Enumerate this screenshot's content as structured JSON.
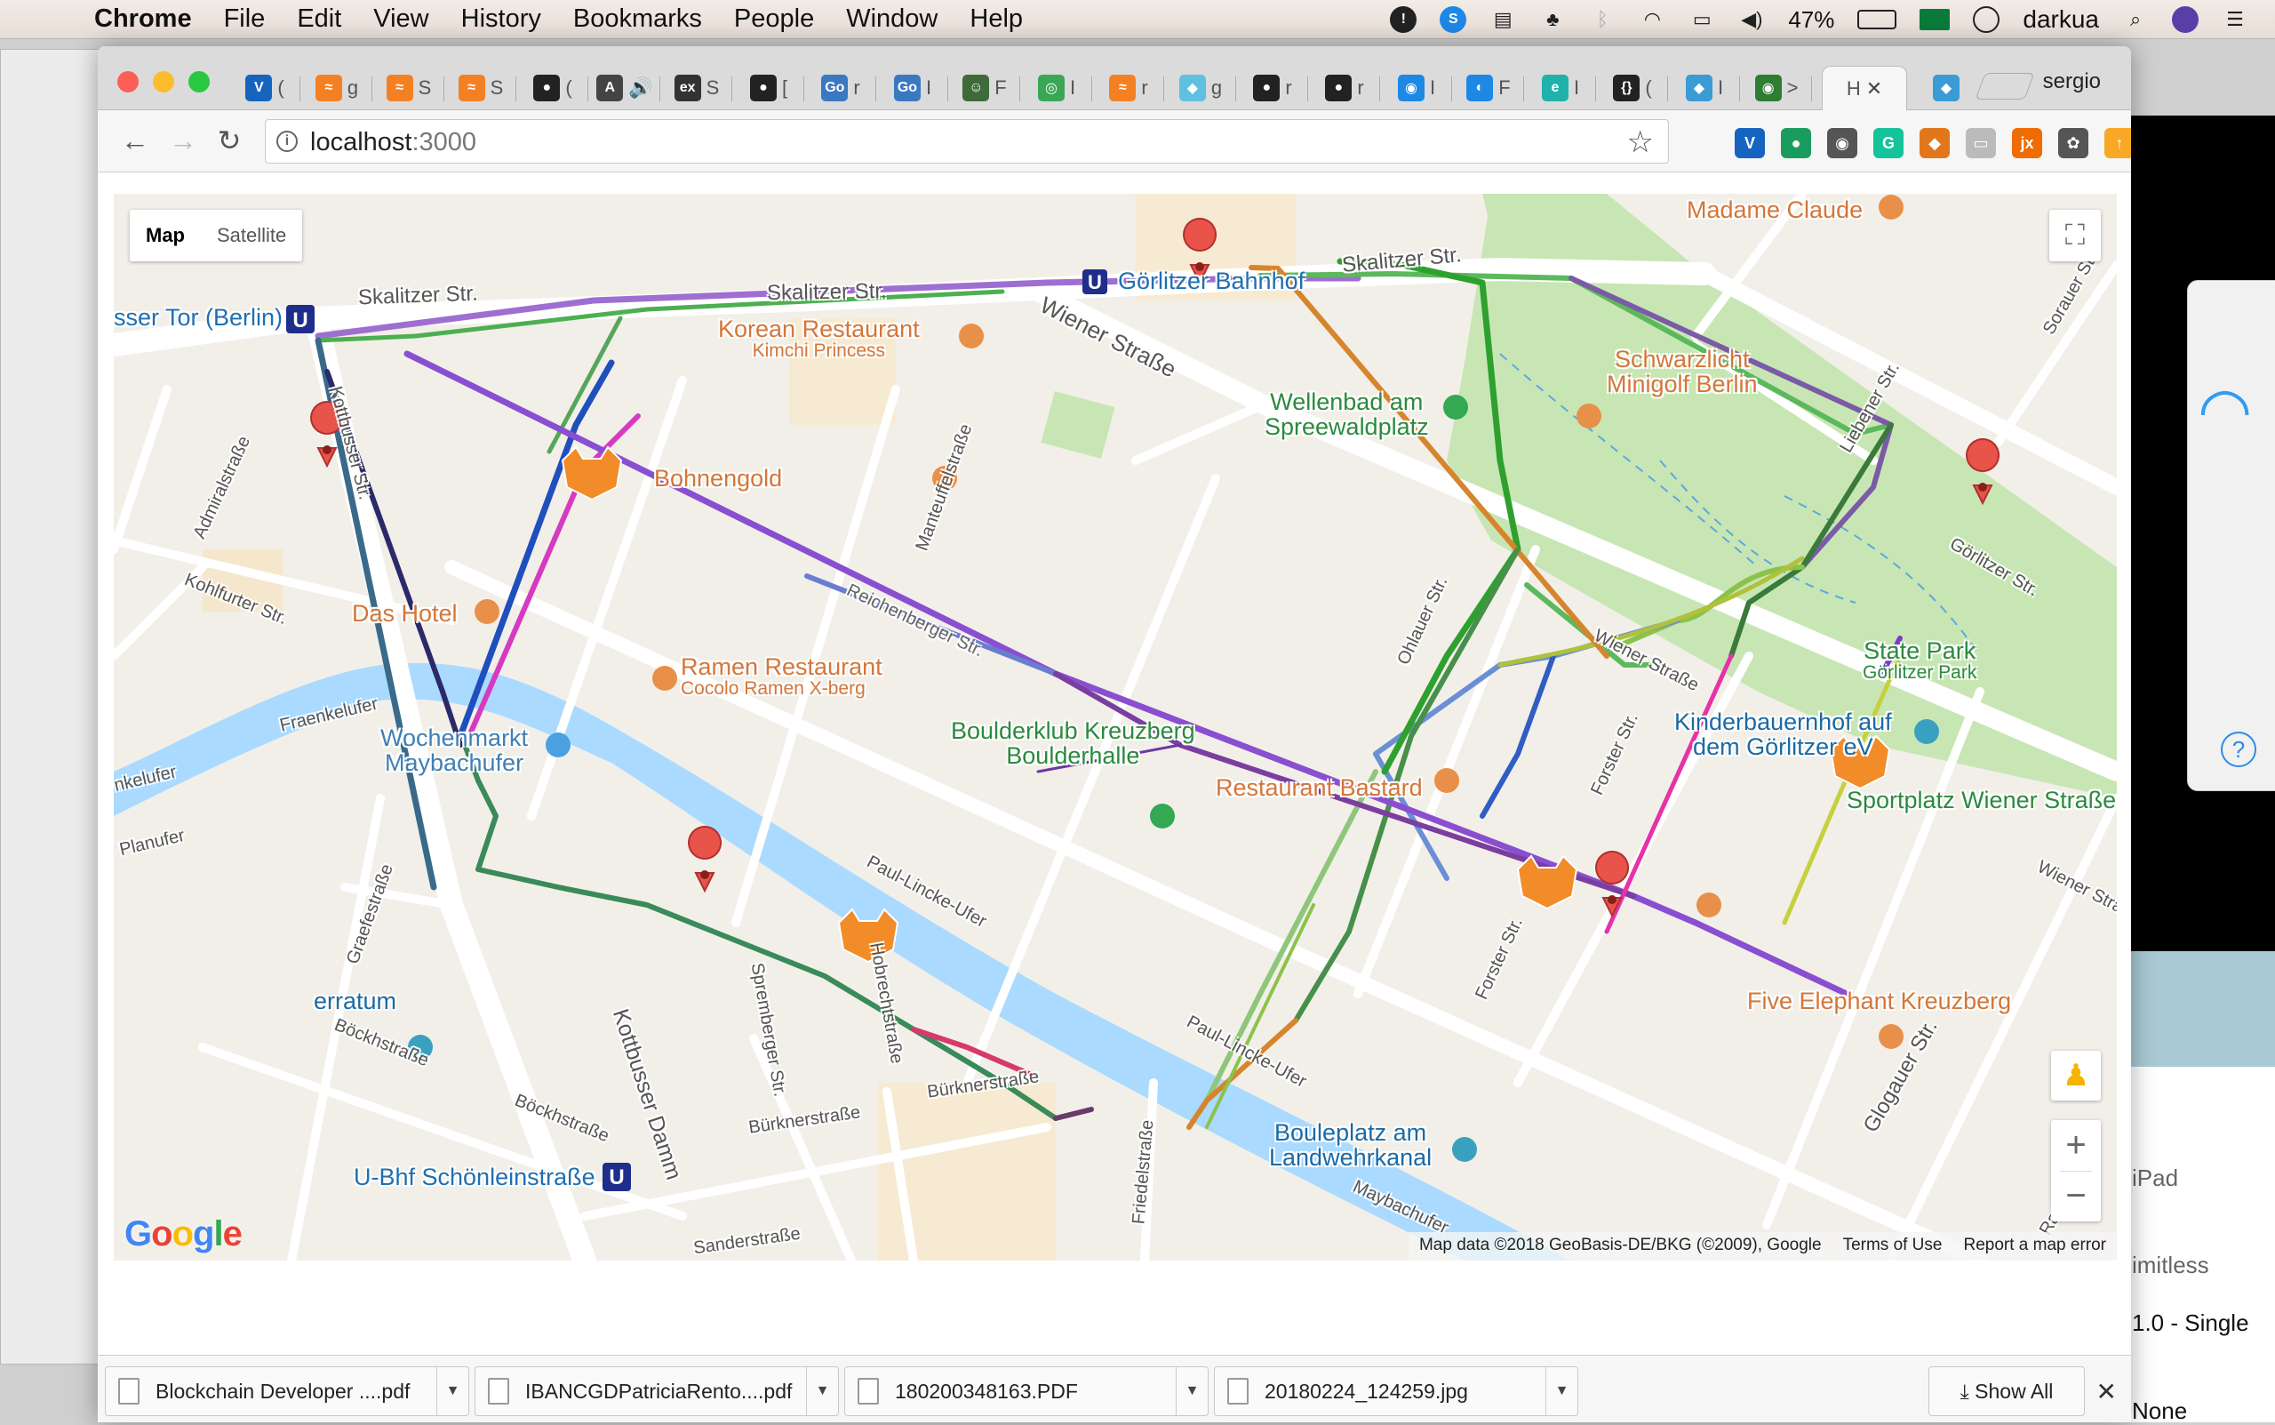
{
  "menubar": {
    "app": "Chrome",
    "items": [
      "File",
      "Edit",
      "View",
      "History",
      "Bookmarks",
      "People",
      "Window",
      "Help"
    ],
    "battery": "47%",
    "user": "darkua"
  },
  "browser": {
    "profile": "sergio",
    "active_tab_title": "H",
    "tabs": [
      {
        "icon": "V",
        "color": "#1565c0",
        "text": "("
      },
      {
        "icon": "≈",
        "color": "#f48024",
        "text": "g"
      },
      {
        "icon": "≈",
        "color": "#f48024",
        "text": "S"
      },
      {
        "icon": "≈",
        "color": "#f48024",
        "text": "S"
      },
      {
        "icon": "●",
        "color": "#222222",
        "text": "("
      },
      {
        "icon": "A",
        "color": "#444444",
        "text": "🔊"
      },
      {
        "icon": "ex",
        "color": "#333333",
        "text": "S"
      },
      {
        "icon": "●",
        "color": "#222222",
        "text": "["
      },
      {
        "icon": "Go",
        "color": "#3b78c2",
        "text": "r"
      },
      {
        "icon": "Go",
        "color": "#3b78c2",
        "text": "I"
      },
      {
        "icon": "☺",
        "color": "#3f6b3a",
        "text": "F"
      },
      {
        "icon": "◎",
        "color": "#3aa757",
        "text": "I"
      },
      {
        "icon": "≈",
        "color": "#f48024",
        "text": "r"
      },
      {
        "icon": "◆",
        "color": "#60c0e0",
        "text": "g"
      },
      {
        "icon": "●",
        "color": "#222222",
        "text": "r"
      },
      {
        "icon": "●",
        "color": "#222222",
        "text": "r"
      },
      {
        "icon": "◉",
        "color": "#1e88e5",
        "text": "I"
      },
      {
        "icon": "◐",
        "color": "#1e88e5",
        "text": "F"
      },
      {
        "icon": "e",
        "color": "#20b2aa",
        "text": "I"
      },
      {
        "icon": "{}",
        "color": "#222222",
        "text": "("
      },
      {
        "icon": "◆",
        "color": "#3a9bd5",
        "text": "I"
      },
      {
        "icon": "◉",
        "color": "#2e7d32",
        "text": ">"
      }
    ],
    "url_host": "localhost",
    "url_port": ":3000",
    "extensions": [
      {
        "icon": "V",
        "color": "#1565c0"
      },
      {
        "icon": "●",
        "color": "#1a9c5f"
      },
      {
        "icon": "◉",
        "color": "#555555"
      },
      {
        "icon": "G",
        "color": "#15c39a"
      },
      {
        "icon": "◆",
        "color": "#e2761b"
      },
      {
        "icon": "▭",
        "color": "#bbbbbb"
      },
      {
        "icon": "jx",
        "color": "#ef6c00"
      },
      {
        "icon": "✿",
        "color": "#555555"
      },
      {
        "icon": "↑",
        "color": "#f9a825"
      }
    ]
  },
  "map": {
    "type_map": "Map",
    "type_satellite": "Satellite",
    "attribution": "Map data ©2018 GeoBasis-DE/BKG (©2009), Google",
    "terms": "Terms of Use",
    "report": "Report a map error",
    "logo": "Google",
    "streets": {
      "skalitzer_1": "Skalitzer Str.",
      "skalitzer_2": "Skalitzer Str.",
      "skalitzer_3": "Skalitzer Str.",
      "wiener": "Wiener Straße",
      "wiener_2": "Wiener Straße",
      "wiener_3": "Wiener Stra",
      "admiral": "Admiralstraße",
      "kohlfurter": "Kohlfurter Str.",
      "fraenkelufer": "Fraenkelufer",
      "nkelufer": "nkelufer",
      "planufer": "Planufer",
      "manteuffel": "Manteuffelstraße",
      "reichenberger": "Reichenberger Str.",
      "paul_linke_1": "Paul-Lincke-Ufer",
      "paul_linke_2": "Paul-Lincke-Ufer",
      "graefe": "Graefestraße",
      "kottbusser": "Kottbusser Damm",
      "boeckh_1": "Böckhstraße",
      "boeckh_2": "Böckhstraße",
      "spremberger": "Spremberger Str.",
      "hobrecht": "Hobrechtstraße",
      "buerkner_1": "Bürknerstraße",
      "buerkner_2": "Bürknerstraße",
      "friedel": "Friedelstraße",
      "sander": "Sanderstraße",
      "maybach": "Maybachufer",
      "forster": "Forster Str.",
      "glogauer": "Glogauer Str.",
      "ratibor": "Ratiborstr.",
      "sorauer": "Sorauer Str.",
      "liebener": "Liebener Str.",
      "goerlitzer": "Görlitzer Str.",
      "ohlauer": "Ohlauer Str.",
      "kottbusser_str": "Kottbusser Str."
    },
    "places": {
      "kotti": "sser Tor (Berlin)",
      "goerlitzer_bf": "Görlitzer Bahnhof",
      "madame": "Madame Claude",
      "korean": "Korean Restaurant",
      "kimchi": "Kimchi Princess",
      "schwarzlicht_1": "Schwarzlicht",
      "schwarzlicht_2": "Minigolf Berlin",
      "wellenbad_1": "Wellenbad am",
      "wellenbad_2": "Spreewaldplatz",
      "bohnengold": "Bohnengold",
      "das_hotel": "Das Hotel",
      "ramen": "Ramen Restaurant",
      "cocolo": "Cocolo Ramen X-berg",
      "boulder_1": "Boulderklub Kreuzberg",
      "boulder_2": "Boulderhalle",
      "bastard": "Restaurant Bastard",
      "state_park": "State Park",
      "goerlitzer_park": "Görlitzer Park",
      "kinder_1": "Kinderbauernhof auf",
      "kinder_2": "dem Görlitzer eV",
      "sportplatz": "Sportplatz Wiener Straße",
      "wochenmarkt_1": "Wochenmarkt",
      "wochenmarkt_2": "Maybachufer",
      "five_elephant": "Five Elephant Kreuzberg",
      "erratum": "erratum",
      "bouleplatz_1": "Bouleplatz am",
      "bouleplatz_2": "Landwehrkanal",
      "schoenlein": "U-Bhf Schönleinstraße"
    }
  },
  "downloads": {
    "items": [
      "Blockchain Developer ....pdf",
      "IBANCGDPatriciaRento....pdf",
      "180200348163.PDF",
      "20180224_124259.jpg"
    ],
    "show_all": "Show All"
  },
  "background": {
    "r1": "iPad",
    "r2": "imitless",
    "r3": "1.0 - Single",
    "r4": "None"
  }
}
